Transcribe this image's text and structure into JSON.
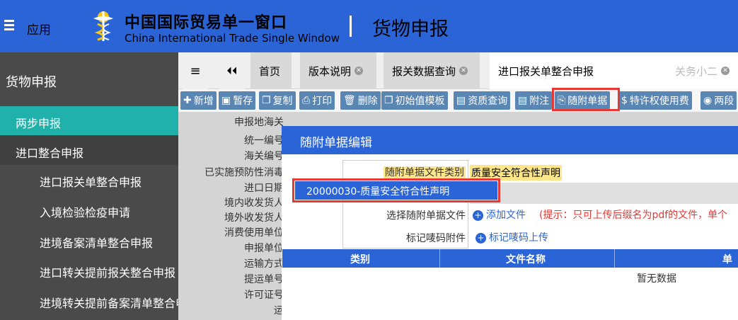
{
  "header": {
    "app_label": "应用",
    "cn_title": "中国国际贸易单一窗口",
    "en_title": "China International Trade Single Window",
    "section_title": "货物申报"
  },
  "sidebar": {
    "title": "货物申报",
    "active_item": "两步申报",
    "group": "进口整合申报",
    "items": [
      "进口报关单整合申报",
      "入境检验检疫申请",
      "进境备案清单整合申报",
      "进口转关提前报关整合申报",
      "进境转关提前备案清单整合申报"
    ]
  },
  "tabs": {
    "home": "首页",
    "version": "版本说明",
    "query": "报关数据查询",
    "current": "进口报关单整合申报",
    "user": "关务小二"
  },
  "toolbar": {
    "new": "新增",
    "save": "暂存",
    "copy": "复制",
    "print": "打印",
    "delete": "删除",
    "template": "初始值模板",
    "qualify": "资质查询",
    "note": "附注",
    "attach": "随附单据",
    "royalty": "特许权使用费",
    "two_step": "两段"
  },
  "form_labels": [
    "申报地海关",
    "统一编号",
    "海关编号",
    "已实施预防性消毒",
    "进口日期",
    "境内收发货人",
    "境外收发货人",
    "消费使用单位",
    "申报单位",
    "运输方式",
    "提运单号",
    "许可证号",
    "运"
  ],
  "modal": {
    "title": "随附单据编辑",
    "file_type_label": "随附单据文件类别",
    "file_type_value": "质量安全符合性声明",
    "dropdown_option": "20000030-质量安全符合性声明",
    "choose_file_label": "选择随附单据文件",
    "add_file_button": "添加文件",
    "hint": "(提示：只可上传后缀名为pdf的文件，单个",
    "mark_label": "标记唛码附件",
    "mark_button": "标记唛码上传",
    "columns": [
      "类别",
      "文件名称",
      "单"
    ],
    "empty": "暂无数据"
  }
}
